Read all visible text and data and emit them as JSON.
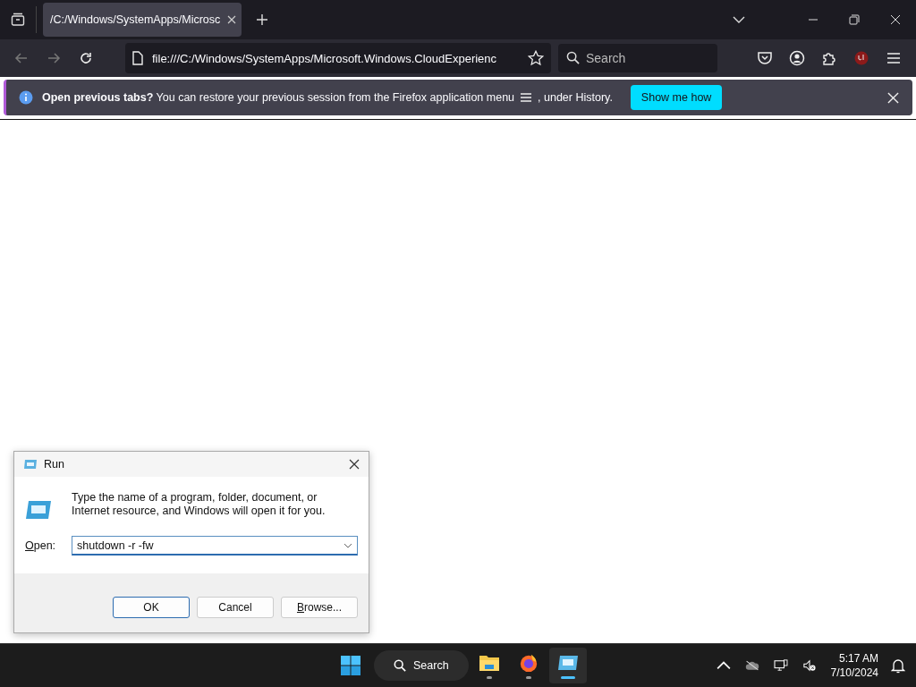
{
  "browser": {
    "tabs": [
      {
        "title": "/C:/Windows/SystemApps/Microsc",
        "selected": true
      }
    ],
    "address": "file:///C:/Windows/SystemApps/Microsoft.Windows.CloudExperienc",
    "search": {
      "placeholder": "Search"
    },
    "notification": {
      "message": "**Open previous tabs?** You can restore your previous session from the Firefox application menu",
      "message_end": ", under History.",
      "button": "Show me how"
    }
  },
  "run_dialog": {
    "title": "Run",
    "description": "Type the name of a program, folder, document, or Internet resource, and Windows will open it for you.",
    "open_label": "Open:",
    "value": "shutdown -r -fw",
    "buttons": [
      {
        "label": "OK",
        "default": true
      },
      {
        "label": "Cancel",
        "default": false
      },
      {
        "label": "Browse...",
        "default": false
      }
    ]
  },
  "taskbar": {
    "search": "Search",
    "apps": [
      {
        "kind": "folder",
        "active": false
      },
      {
        "kind": "browser",
        "active": false
      },
      {
        "kind": "run",
        "active": true
      }
    ],
    "time": "5:17 AM",
    "date": "7/10/2024"
  }
}
